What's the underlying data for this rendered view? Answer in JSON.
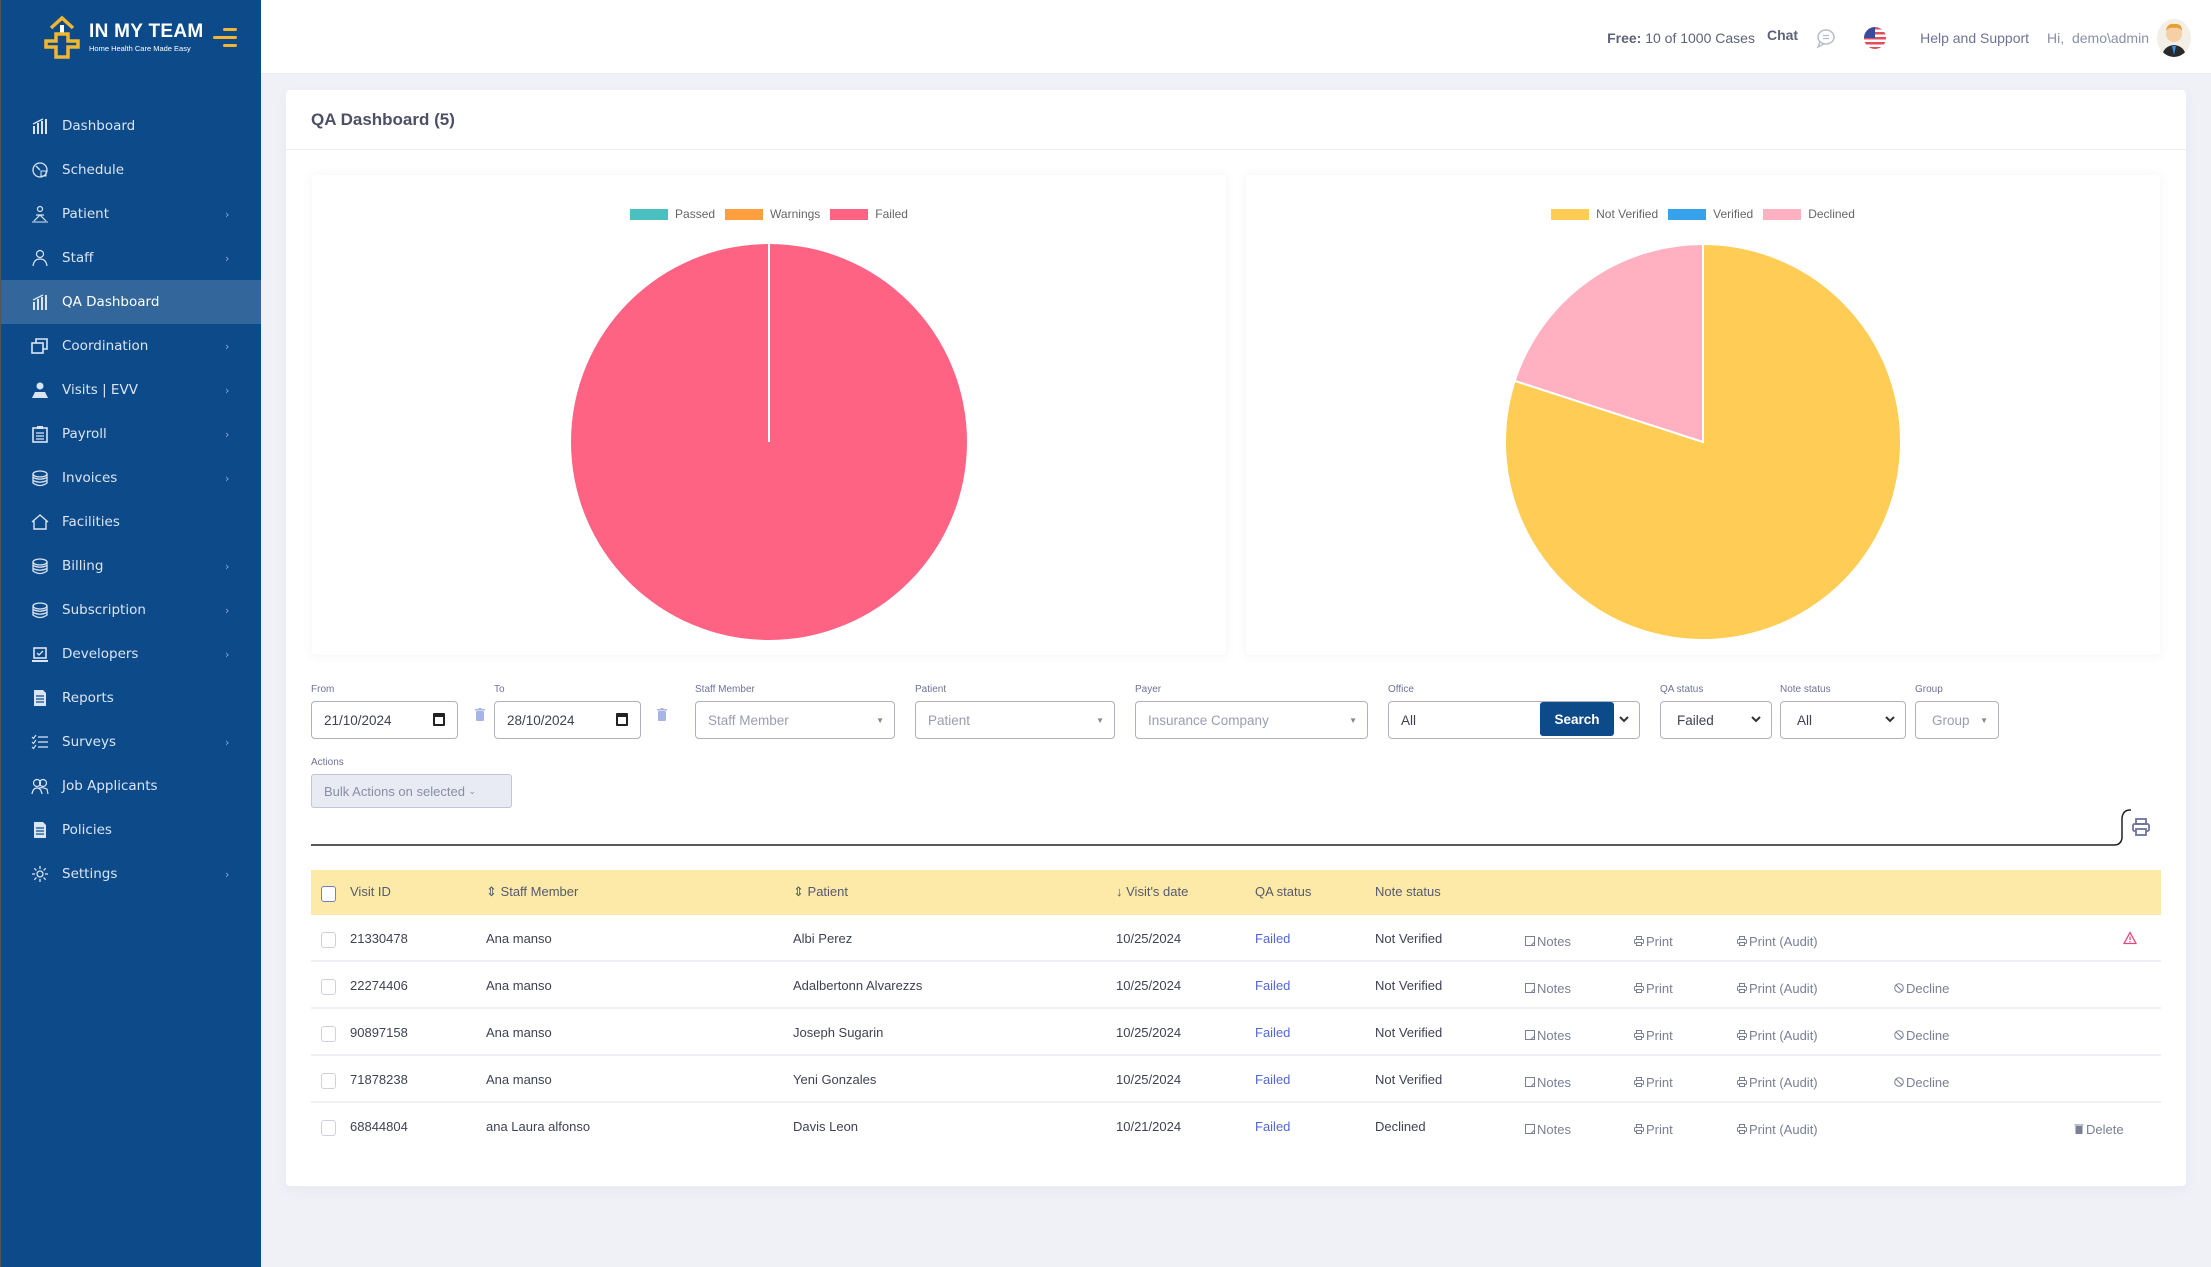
{
  "app": {
    "logo_title": "IN MY TEAM",
    "logo_subtitle": "Home Health Care Made Easy",
    "brand_color": "#0c4a8a",
    "accent_color": "#f2b632"
  },
  "header": {
    "free_label": "Free:",
    "free_value": "10 of 1000 Cases",
    "chat_label": "Chat",
    "help_label": "Help and Support",
    "greeting": "Hi,",
    "username": "demo\\admin"
  },
  "sidebar": {
    "items": [
      {
        "label": "Dashboard",
        "icon": "chart-icon",
        "chevron": false,
        "active": false
      },
      {
        "label": "Schedule",
        "icon": "clock-icon",
        "chevron": false,
        "active": false
      },
      {
        "label": "Patient",
        "icon": "patient-icon",
        "chevron": true,
        "active": false
      },
      {
        "label": "Staff",
        "icon": "staff-icon",
        "chevron": true,
        "active": false
      },
      {
        "label": "QA Dashboard",
        "icon": "chart-icon",
        "chevron": false,
        "active": true
      },
      {
        "label": "Coordination",
        "icon": "windows-icon",
        "chevron": true,
        "active": false
      },
      {
        "label": "Visits | EVV",
        "icon": "location-user-icon",
        "chevron": true,
        "active": false
      },
      {
        "label": "Payroll",
        "icon": "clipboard-icon",
        "chevron": true,
        "active": false
      },
      {
        "label": "Invoices",
        "icon": "coins-icon",
        "chevron": true,
        "active": false
      },
      {
        "label": "Facilities",
        "icon": "home-icon",
        "chevron": false,
        "active": false
      },
      {
        "label": "Billing",
        "icon": "coins-icon",
        "chevron": true,
        "active": false
      },
      {
        "label": "Subscription",
        "icon": "coins-icon",
        "chevron": true,
        "active": false
      },
      {
        "label": "Developers",
        "icon": "laptop-icon",
        "chevron": true,
        "active": false
      },
      {
        "label": "Reports",
        "icon": "document-icon",
        "chevron": false,
        "active": false
      },
      {
        "label": "Surveys",
        "icon": "checklist-icon",
        "chevron": true,
        "active": false
      },
      {
        "label": "Job Applicants",
        "icon": "users-icon",
        "chevron": false,
        "active": false
      },
      {
        "label": "Policies",
        "icon": "document-icon",
        "chevron": false,
        "active": false
      },
      {
        "label": "Settings",
        "icon": "gear-icon",
        "chevron": true,
        "active": false
      }
    ]
  },
  "page": {
    "title": "QA Dashboard (5)"
  },
  "chart_data": [
    {
      "type": "pie",
      "title": "",
      "legend_position": "top",
      "categories": [
        "Passed",
        "Warnings",
        "Failed"
      ],
      "values": [
        0,
        0,
        5
      ],
      "colors": [
        "#4bc0c0",
        "#ff9f40",
        "#ff6384"
      ]
    },
    {
      "type": "pie",
      "title": "",
      "legend_position": "top",
      "categories": [
        "Not Verified",
        "Verified",
        "Declined"
      ],
      "values": [
        4,
        0,
        1
      ],
      "colors": [
        "#ffcd56",
        "#36a2eb",
        "#ffb1c1"
      ]
    }
  ],
  "filters": {
    "from": {
      "label": "From",
      "value": "21/10/2024"
    },
    "to": {
      "label": "To",
      "value": "28/10/2024"
    },
    "staff": {
      "label": "Staff Member",
      "placeholder": "Staff Member"
    },
    "patient": {
      "label": "Patient",
      "placeholder": "Patient"
    },
    "payer": {
      "label": "Payer",
      "placeholder": "Insurance Company"
    },
    "office": {
      "label": "Office",
      "value": "All"
    },
    "qa_status": {
      "label": "QA status",
      "value": "Failed"
    },
    "note_status": {
      "label": "Note status",
      "value": "All"
    },
    "group": {
      "label": "Group",
      "placeholder": "Group"
    },
    "search_label": "Search"
  },
  "actions": {
    "label": "Actions",
    "bulk_label": "Bulk Actions on selected"
  },
  "table": {
    "columns": {
      "visit_id": "Visit ID",
      "staff": "Staff Member",
      "patient": "Patient",
      "date": "Visit's date",
      "qa_status": "QA status",
      "note_status": "Note status"
    },
    "sort_icons": {
      "staff": "⇕",
      "patient": "⇕",
      "date": "↓"
    },
    "action_labels": {
      "notes": "Notes",
      "print": "Print",
      "print_audit": "Print (Audit)",
      "decline": "Decline",
      "delete": "Delete"
    },
    "rows": [
      {
        "visit_id": "21330478",
        "staff": "Ana manso",
        "patient": "Albi Perez",
        "date": "10/25/2024",
        "qa_status": "Failed",
        "note_status": "Not Verified",
        "decline": false,
        "delete": false,
        "warning": true
      },
      {
        "visit_id": "22274406",
        "staff": "Ana manso",
        "patient": "Adalbertonn Alvarezzs",
        "date": "10/25/2024",
        "qa_status": "Failed",
        "note_status": "Not Verified",
        "decline": true,
        "delete": false,
        "warning": false
      },
      {
        "visit_id": "90897158",
        "staff": "Ana manso",
        "patient": "Joseph Sugarin",
        "date": "10/25/2024",
        "qa_status": "Failed",
        "note_status": "Not Verified",
        "decline": true,
        "delete": false,
        "warning": false
      },
      {
        "visit_id": "71878238",
        "staff": "Ana manso",
        "patient": "Yeni Gonzales",
        "date": "10/25/2024",
        "qa_status": "Failed",
        "note_status": "Not Verified",
        "decline": true,
        "delete": false,
        "warning": false
      },
      {
        "visit_id": "68844804",
        "staff": "ana Laura alfonso",
        "patient": "Davis Leon",
        "date": "10/21/2024",
        "qa_status": "Failed",
        "note_status": "Declined",
        "decline": false,
        "delete": true,
        "warning": false
      }
    ]
  }
}
